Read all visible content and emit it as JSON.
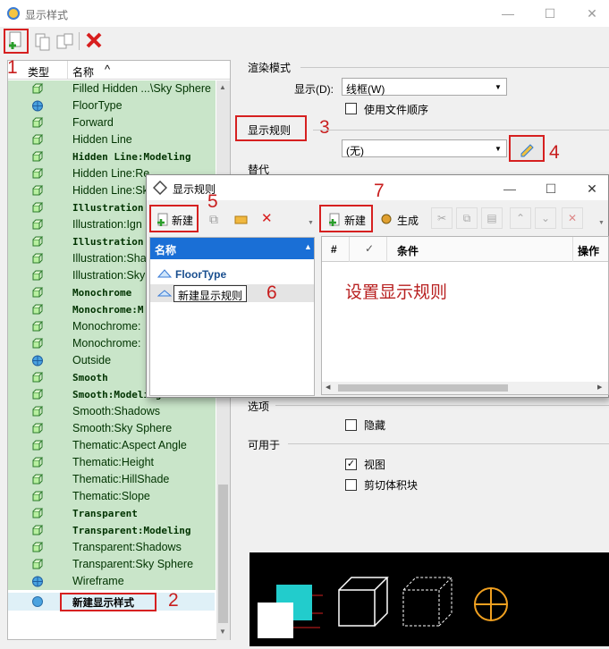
{
  "window": {
    "title": "显示样式",
    "minimize": "—",
    "maximize": "☐",
    "close": "✕"
  },
  "toolbar": {
    "new_icon": "new-document-icon",
    "copy_icon": "copy-icon",
    "rename_icon": "rename-icon",
    "delete_icon": "delete-icon"
  },
  "list": {
    "col_type": "类型",
    "col_name": "名称",
    "sort_glyph": "^",
    "items": [
      {
        "name": "Filled Hidden ...\\Sky Sphere",
        "bold": false
      },
      {
        "name": "FloorType",
        "bold": false
      },
      {
        "name": "Forward",
        "bold": false
      },
      {
        "name": "Hidden Line",
        "bold": false
      },
      {
        "name": "Hidden Line:Modeling",
        "bold": true
      },
      {
        "name": "Hidden Line:Re",
        "bold": false
      },
      {
        "name": "Hidden Line:Sk",
        "bold": false
      },
      {
        "name": "Illustration",
        "bold": true
      },
      {
        "name": "Illustration:Ign",
        "bold": false
      },
      {
        "name": "Illustration",
        "bold": true
      },
      {
        "name": "Illustration:Sha",
        "bold": false
      },
      {
        "name": "Illustration:Sky",
        "bold": false
      },
      {
        "name": "Monochrome",
        "bold": true
      },
      {
        "name": "Monochrome:M",
        "bold": true
      },
      {
        "name": "Monochrome:",
        "bold": false
      },
      {
        "name": "Monochrome:",
        "bold": false
      },
      {
        "name": "Outside",
        "bold": false
      },
      {
        "name": "Smooth",
        "bold": true
      },
      {
        "name": "Smooth:Modeling",
        "bold": true
      },
      {
        "name": "Smooth:Shadows",
        "bold": false
      },
      {
        "name": "Smooth:Sky Sphere",
        "bold": false
      },
      {
        "name": "Thematic:Aspect Angle",
        "bold": false
      },
      {
        "name": "Thematic:Height",
        "bold": false
      },
      {
        "name": "Thematic:HillShade",
        "bold": false
      },
      {
        "name": "Thematic:Slope",
        "bold": false
      },
      {
        "name": "Transparent",
        "bold": true
      },
      {
        "name": "Transparent:Modeling",
        "bold": true
      },
      {
        "name": "Transparent:Shadows",
        "bold": false
      },
      {
        "name": "Transparent:Sky Sphere",
        "bold": false
      },
      {
        "name": "Wireframe",
        "bold": false
      }
    ],
    "new_item": "新建显示样式"
  },
  "render": {
    "section": "渲染模式",
    "display_label": "显示(D):",
    "display_value": "线框(W)",
    "use_file_order": "使用文件顺序"
  },
  "rules": {
    "label": "显示规则",
    "value": "(无)"
  },
  "override": {
    "label": "替代"
  },
  "options": {
    "label": "选项",
    "hide": "隐藏"
  },
  "applies": {
    "label": "可用于",
    "view": "视图",
    "clip": "剪切体积块"
  },
  "dialog": {
    "title": "显示规则",
    "new_button": "新建",
    "new_button2": "新建",
    "generate_button": "生成",
    "col_name": "名称",
    "col_hash": "#",
    "col_check": "✓",
    "col_condition": "条件",
    "col_action": "操作",
    "items": [
      "FloorType",
      "新建显示规则"
    ],
    "hint": "设置显示规则"
  },
  "steps": [
    "1",
    "2",
    "3",
    "4",
    "5",
    "6",
    "7"
  ],
  "colors": {
    "row_bg": "#c9e5c9",
    "accent_red": "#c81e1e",
    "title_blue": "#1a5fb4"
  }
}
